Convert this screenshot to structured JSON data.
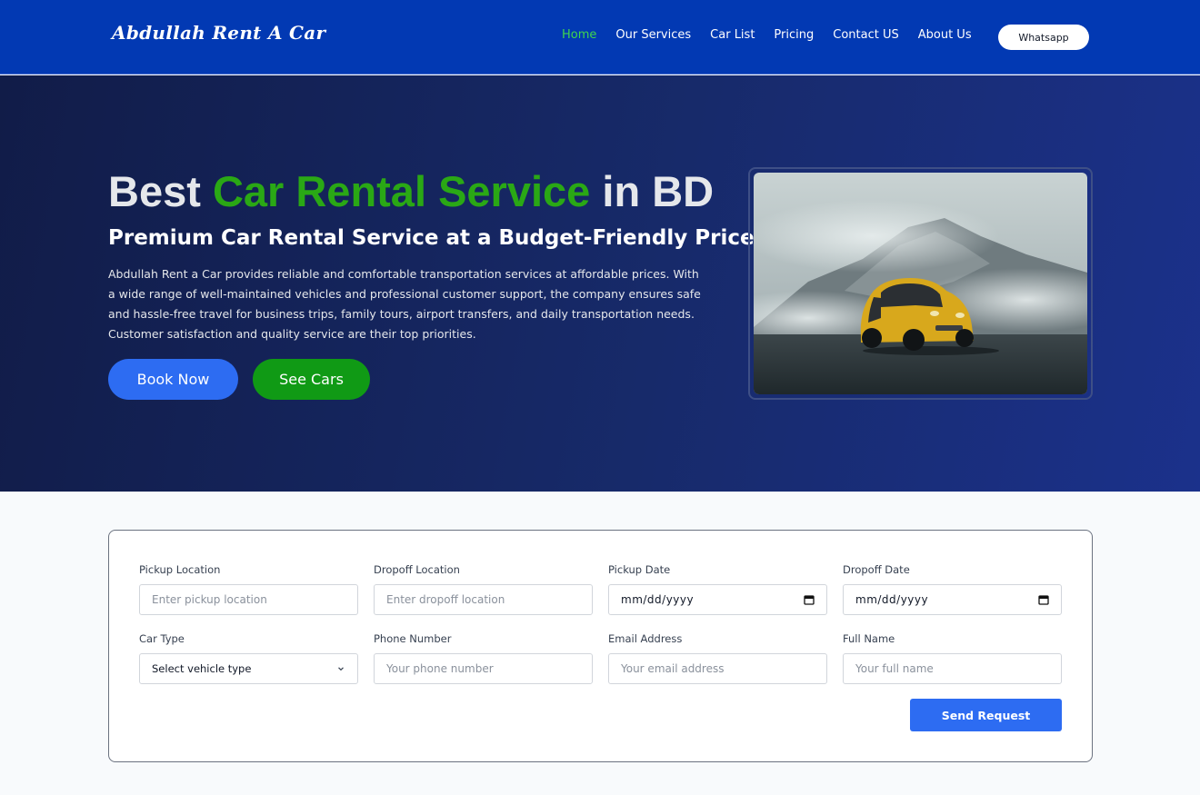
{
  "nav": {
    "brand": "Abdullah Rent A Car",
    "links": [
      "Home",
      "Our Services",
      "Car List",
      "Pricing",
      "Contact US",
      "About Us"
    ],
    "whatsapp_label": "Whatsapp"
  },
  "hero": {
    "title_prefix": "Best ",
    "title_accent": "Car Rental Service",
    "title_suffix": " in BD",
    "subtitle": "Premium Car Rental Service at a Budget-Friendly Price",
    "description": "Abdullah Rent a Car provides reliable and comfortable transportation services at affordable prices. With a wide range of well-maintained vehicles and professional customer support, the company ensures safe and hassle-free travel for business trips, family tours, airport transfers, and daily transportation needs. Customer satisfaction and quality service are their top priorities.",
    "book_label": "Book Now",
    "see_cars_label": "See Cars"
  },
  "form": {
    "pickup_location": {
      "label": "Pickup Location",
      "placeholder": "Enter pickup location"
    },
    "dropoff_location": {
      "label": "Dropoff Location",
      "placeholder": "Enter dropoff location"
    },
    "pickup_date": {
      "label": "Pickup Date",
      "value": "mm/dd/yyyy"
    },
    "dropoff_date": {
      "label": "Dropoff Date",
      "value": "mm/dd/yyyy"
    },
    "car_type": {
      "label": "Car Type",
      "selected": "Select vehicle type"
    },
    "phone": {
      "label": "Phone Number",
      "placeholder": "Your phone number"
    },
    "email": {
      "label": "Email Address",
      "placeholder": "Your email address"
    },
    "full_name": {
      "label": "Full Name",
      "placeholder": "Your full name"
    },
    "submit_label": "Send Request"
  },
  "colors": {
    "nav_bg": "#0239b3",
    "active_link": "#3fd64d",
    "accent_green": "#2aa815",
    "primary_blue": "#2d6cf2",
    "see_cars_green": "#109a15"
  }
}
